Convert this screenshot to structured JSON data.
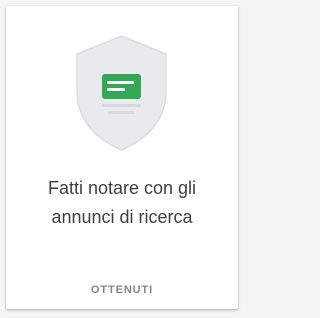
{
  "achievement": {
    "title_line1": "Fatti notare con gli",
    "title_line2": "annunci di ricerca",
    "status": "OTTENUTI",
    "icon": "shield-ad-badge-icon",
    "colors": {
      "shield_fill": "#e8eaed",
      "shield_border": "#dadce0",
      "ad_box": "#34a853",
      "ad_lines": "#ffffff",
      "text_lines": "#d7d9dd"
    }
  }
}
